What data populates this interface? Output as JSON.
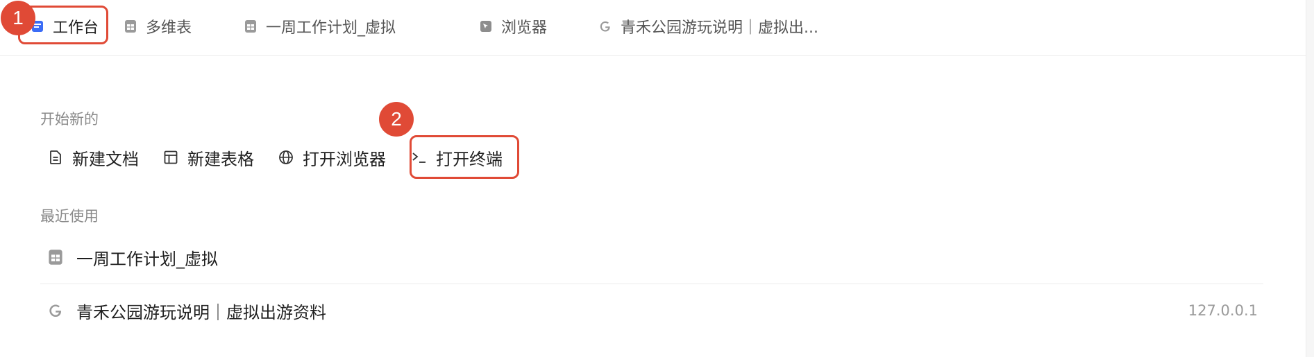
{
  "tabs": [
    {
      "label": "工作台",
      "icon": "workspace-icon",
      "active": true
    },
    {
      "label": "多维表",
      "icon": "table-doc-icon"
    },
    {
      "label": "一周工作计划_虚拟",
      "icon": "table-doc-icon"
    },
    {
      "label": "浏览器",
      "icon": "browser-icon"
    },
    {
      "label": "青禾公园游玩说明｜虚拟出...",
      "icon": "google-icon"
    }
  ],
  "start_new": {
    "title": "开始新的",
    "actions": [
      {
        "label": "新建文档",
        "icon": "document-icon"
      },
      {
        "label": "新建表格",
        "icon": "sheet-icon"
      },
      {
        "label": "打开浏览器",
        "icon": "globe-icon"
      },
      {
        "label": "打开终端",
        "icon": "terminal-icon"
      }
    ]
  },
  "recent": {
    "title": "最近使用",
    "items": [
      {
        "label": "一周工作计划_虚拟",
        "icon": "table-doc-icon",
        "meta": ""
      },
      {
        "label": "青禾公园游玩说明｜虚拟出游资料",
        "icon": "google-icon",
        "meta": "127.0.0.1"
      }
    ]
  },
  "annotations": {
    "badge1": "1",
    "badge2": "2",
    "color": "#e04a36"
  }
}
